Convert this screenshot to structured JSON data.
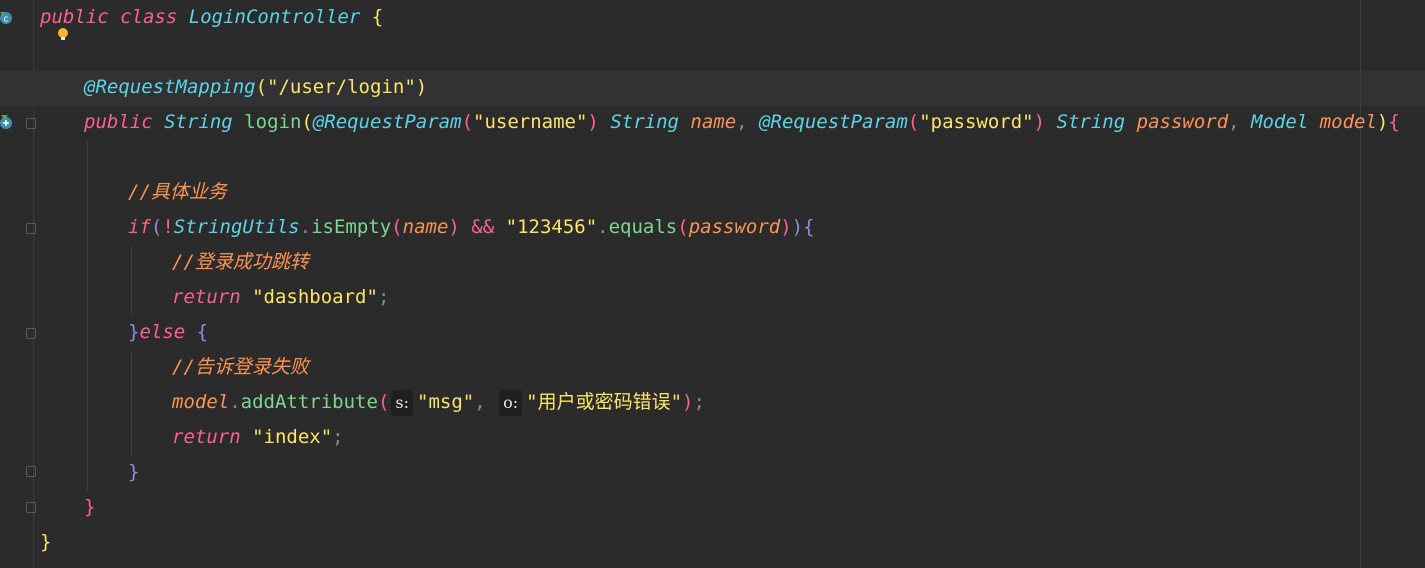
{
  "editor": {
    "language": "java",
    "lines": [
      {
        "indent": 0,
        "tokens": [
          {
            "t": "public",
            "c": "kw"
          },
          {
            "t": " "
          },
          {
            "t": "class",
            "c": "kw"
          },
          {
            "t": " "
          },
          {
            "t": "LoginController",
            "c": "cls"
          },
          {
            "t": " "
          },
          {
            "t": "{",
            "c": "p1"
          }
        ]
      },
      {
        "indent": 0,
        "tokens": []
      },
      {
        "indent": 1,
        "tokens": [
          {
            "t": "@RequestMapping",
            "c": "ann"
          },
          {
            "t": "(",
            "c": "p1"
          },
          {
            "t": "\"/user/login\"",
            "c": "str"
          },
          {
            "t": ")",
            "c": "p1"
          }
        ]
      },
      {
        "indent": 1,
        "tokens": [
          {
            "t": "public",
            "c": "kw"
          },
          {
            "t": " "
          },
          {
            "t": "String",
            "c": "cls"
          },
          {
            "t": " "
          },
          {
            "t": "login",
            "c": "fn"
          },
          {
            "t": "(",
            "c": "p1"
          },
          {
            "t": "@RequestParam",
            "c": "ann"
          },
          {
            "t": "(",
            "c": "p2"
          },
          {
            "t": "\"username\"",
            "c": "str"
          },
          {
            "t": ")",
            "c": "p2"
          },
          {
            "t": " "
          },
          {
            "t": "String",
            "c": "cls"
          },
          {
            "t": " "
          },
          {
            "t": "name",
            "c": "par"
          },
          {
            "t": ", ",
            "c": "dim"
          },
          {
            "t": "@RequestParam",
            "c": "ann"
          },
          {
            "t": "(",
            "c": "p2"
          },
          {
            "t": "\"password\"",
            "c": "str"
          },
          {
            "t": ")",
            "c": "p2"
          },
          {
            "t": " "
          },
          {
            "t": "String",
            "c": "cls"
          },
          {
            "t": " "
          },
          {
            "t": "password",
            "c": "par"
          },
          {
            "t": ", ",
            "c": "dim"
          },
          {
            "t": "Model",
            "c": "cls"
          },
          {
            "t": " "
          },
          {
            "t": "model",
            "c": "par"
          },
          {
            "t": ")",
            "c": "p1"
          },
          {
            "t": "{",
            "c": "p2"
          }
        ]
      },
      {
        "indent": 1,
        "tokens": []
      },
      {
        "indent": 2,
        "tokens": [
          {
            "t": "//具体业务",
            "c": "cmt"
          }
        ]
      },
      {
        "indent": 2,
        "tokens": [
          {
            "t": "if",
            "c": "kw"
          },
          {
            "t": "(",
            "c": "p3"
          },
          {
            "t": "!",
            "c": "p2"
          },
          {
            "t": "StringUtils",
            "c": "cls"
          },
          {
            "t": ".",
            "c": "dim"
          },
          {
            "t": "isEmpty",
            "c": "fn"
          },
          {
            "t": "(",
            "c": "p2"
          },
          {
            "t": "name",
            "c": "par"
          },
          {
            "t": ")",
            "c": "p2"
          },
          {
            "t": " "
          },
          {
            "t": "&&",
            "c": "p2"
          },
          {
            "t": " "
          },
          {
            "t": "\"123456\"",
            "c": "str"
          },
          {
            "t": ".",
            "c": "dim"
          },
          {
            "t": "equals",
            "c": "fn"
          },
          {
            "t": "(",
            "c": "p2"
          },
          {
            "t": "password",
            "c": "par"
          },
          {
            "t": ")",
            "c": "p2"
          },
          {
            "t": ")",
            "c": "p3"
          },
          {
            "t": "{",
            "c": "p3"
          }
        ]
      },
      {
        "indent": 3,
        "tokens": [
          {
            "t": "//登录成功跳转",
            "c": "cmt"
          }
        ]
      },
      {
        "indent": 3,
        "tokens": [
          {
            "t": "return",
            "c": "kw"
          },
          {
            "t": " "
          },
          {
            "t": "\"dashboard\"",
            "c": "str"
          },
          {
            "t": ";",
            "c": "dim"
          }
        ]
      },
      {
        "indent": 2,
        "tokens": [
          {
            "t": "}",
            "c": "p3"
          },
          {
            "t": "else",
            "c": "kw"
          },
          {
            "t": " "
          },
          {
            "t": "{",
            "c": "p3"
          }
        ]
      },
      {
        "indent": 3,
        "tokens": [
          {
            "t": "//告诉登录失败",
            "c": "cmt"
          }
        ]
      },
      {
        "indent": 3,
        "tokens": [
          {
            "t": "model",
            "c": "par"
          },
          {
            "t": ".",
            "c": "dim"
          },
          {
            "t": "addAttribute",
            "c": "fn"
          },
          {
            "t": "(",
            "c": "p2"
          },
          {
            "t": "s:",
            "c": "hint"
          },
          {
            "t": "\"msg\"",
            "c": "str"
          },
          {
            "t": ", ",
            "c": "dim"
          },
          {
            "t": "o:",
            "c": "hint"
          },
          {
            "t": "\"用户或密码错误\"",
            "c": "str"
          },
          {
            "t": ")",
            "c": "p2"
          },
          {
            "t": ";",
            "c": "dim"
          }
        ]
      },
      {
        "indent": 3,
        "tokens": [
          {
            "t": "return",
            "c": "kw"
          },
          {
            "t": " "
          },
          {
            "t": "\"index\"",
            "c": "str"
          },
          {
            "t": ";",
            "c": "dim"
          }
        ]
      },
      {
        "indent": 2,
        "tokens": [
          {
            "t": "}",
            "c": "p3"
          }
        ]
      },
      {
        "indent": 1,
        "tokens": [
          {
            "t": "}",
            "c": "p2"
          }
        ]
      },
      {
        "indent": 0,
        "tokens": [
          {
            "t": "}",
            "c": "p1"
          }
        ]
      }
    ]
  },
  "gutter": {
    "icons": [
      "class-run-icon",
      "intention-bulb-icon",
      "method-run-icon"
    ]
  }
}
